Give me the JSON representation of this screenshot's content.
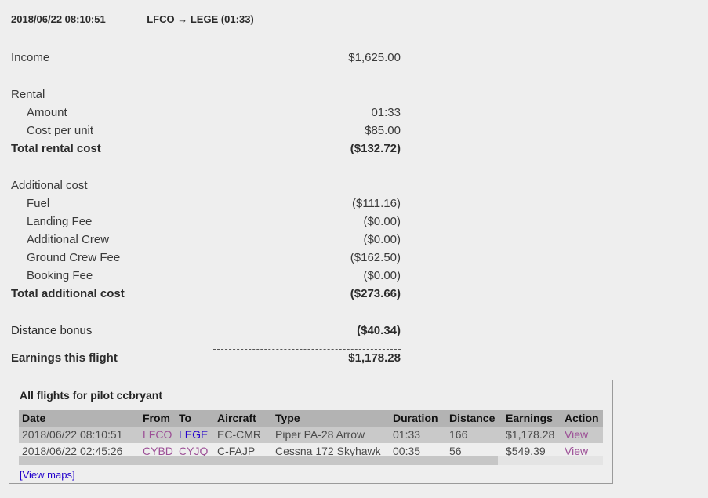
{
  "header": {
    "timestamp": "2018/06/22 08:10:51",
    "route": "LFCO → LEGE (01:33)"
  },
  "summary": {
    "income_label": "Income",
    "income_value": "$1,625.00",
    "rental_label": "Rental",
    "rental_amount_label": "Amount",
    "rental_amount_value": "01:33",
    "rental_cost_per_unit_label": "Cost per unit",
    "rental_cost_per_unit_value": "$85.00",
    "total_rental_label": "Total rental cost",
    "total_rental_value": "($132.72)",
    "additional_label": "Additional cost",
    "fuel_label": "Fuel",
    "fuel_value": "($111.16)",
    "landing_fee_label": "Landing Fee",
    "landing_fee_value": "($0.00)",
    "additional_crew_label": "Additional Crew",
    "additional_crew_value": "($0.00)",
    "ground_crew_fee_label": "Ground Crew Fee",
    "ground_crew_fee_value": "($162.50)",
    "booking_fee_label": "Booking Fee",
    "booking_fee_value": "($0.00)",
    "total_additional_label": "Total additional cost",
    "total_additional_value": "($273.66)",
    "distance_bonus_label": "Distance bonus",
    "distance_bonus_value": "($40.34)",
    "earnings_label": "Earnings this flight",
    "earnings_value": "$1,178.28"
  },
  "flights_panel": {
    "title": "All flights for pilot ccbryant",
    "columns": [
      "Date",
      "From",
      "To",
      "Aircraft",
      "Type",
      "Duration",
      "Distance",
      "Earnings",
      "Action"
    ],
    "rows": [
      {
        "date": "2018/06/22 08:10:51",
        "from": "LFCO",
        "from_link_state": "visited",
        "to": "LEGE",
        "to_link_state": "unvisited",
        "aircraft": "EC-CMR",
        "type": "Piper PA-28 Arrow",
        "duration": "01:33",
        "distance": "166",
        "earnings": "$1,178.28",
        "action": "View"
      },
      {
        "date": "2018/06/22 02:45:26",
        "from": "CYBD",
        "from_link_state": "visited",
        "to": "CYJQ",
        "to_link_state": "visited",
        "aircraft": "C-FAJP",
        "type": "Cessna 172 Skyhawk",
        "duration": "00:35",
        "distance": "56",
        "earnings": "$549.39",
        "action": "View"
      }
    ],
    "view_maps_label": "[View maps]"
  },
  "colors": {
    "page_background": "#eeeeee",
    "text": "#3a3a3a",
    "table_header_bg": "#b3b3b3",
    "table_row_alt_bg": "#c9c9c9",
    "link_visited": "#9c4f96",
    "link_unvisited": "#2200cc",
    "panel_border": "#9a9a9a",
    "scrollbar_thumb": "#c6c6c6"
  }
}
